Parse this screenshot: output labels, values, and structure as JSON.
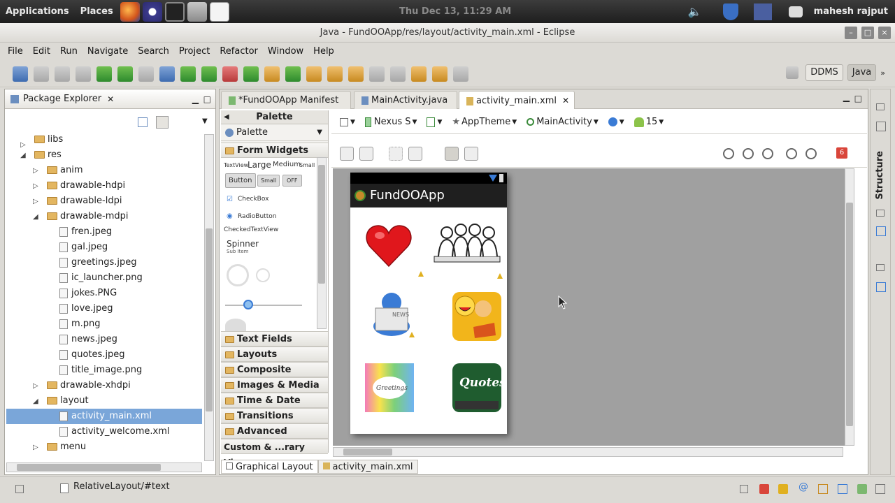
{
  "desktop": {
    "applications": "Applications",
    "places": "Places",
    "clock": "Thu Dec 13, 11:29 AM",
    "user": "mahesh rajput"
  },
  "window": {
    "title": "Java - FundOOApp/res/layout/activity_main.xml - Eclipse"
  },
  "menu": [
    "File",
    "Edit",
    "Run",
    "Navigate",
    "Search",
    "Project",
    "Refactor",
    "Window",
    "Help"
  ],
  "perspectives": {
    "ddms": "DDMS",
    "java": "Java"
  },
  "package_explorer": {
    "title": "Package Explorer",
    "items": [
      {
        "label": "libs"
      },
      {
        "label": "res"
      },
      {
        "label": "anim"
      },
      {
        "label": "drawable-hdpi"
      },
      {
        "label": "drawable-ldpi"
      },
      {
        "label": "drawable-mdpi"
      },
      {
        "label": "fren.jpeg"
      },
      {
        "label": "gal.jpeg"
      },
      {
        "label": "greetings.jpeg"
      },
      {
        "label": "ic_launcher.png"
      },
      {
        "label": "jokes.PNG"
      },
      {
        "label": "love.jpeg"
      },
      {
        "label": "m.png"
      },
      {
        "label": "news.jpeg"
      },
      {
        "label": "quotes.jpeg"
      },
      {
        "label": "title_image.png"
      },
      {
        "label": "drawable-xhdpi"
      },
      {
        "label": "layout"
      },
      {
        "label": "activity_main.xml"
      },
      {
        "label": "activity_welcome.xml"
      },
      {
        "label": "menu"
      }
    ]
  },
  "editor": {
    "tabs": [
      "*FundOOApp Manifest",
      "MainActivity.java",
      "activity_main.xml"
    ],
    "bottom_tabs": [
      "Graphical Layout",
      "activity_main.xml"
    ]
  },
  "palette": {
    "header": "Palette",
    "dropdown": "Palette",
    "widgets": {
      "textview": "TextView",
      "large": "Large",
      "medium": "Medium",
      "small": "Small",
      "button": "Button",
      "small_button": "Small",
      "toggle": "OFF",
      "checkbox": "CheckBox",
      "radio": "RadioButton",
      "checked_text": "CheckedTextView",
      "spinner": "Spinner",
      "spinner_sub": "Sub Item"
    },
    "sections": [
      "Form Widgets",
      "Text Fields",
      "Layouts",
      "Composite",
      "Images & Media",
      "Time & Date",
      "Transitions",
      "Advanced",
      "Custom & ...rary Views"
    ]
  },
  "config": {
    "device": "Nexus S",
    "theme": "AppTheme",
    "activity": "MainActivity",
    "api": "15",
    "errors": "6"
  },
  "device_screen": {
    "app_title": "FundOOApp",
    "quotes_label": "Quotes"
  },
  "status": {
    "text": "RelativeLayout/#text"
  },
  "structure_label": "Structure",
  "colors": {
    "selection": "#7aa6d9",
    "canvas": "#a0a0a0"
  }
}
